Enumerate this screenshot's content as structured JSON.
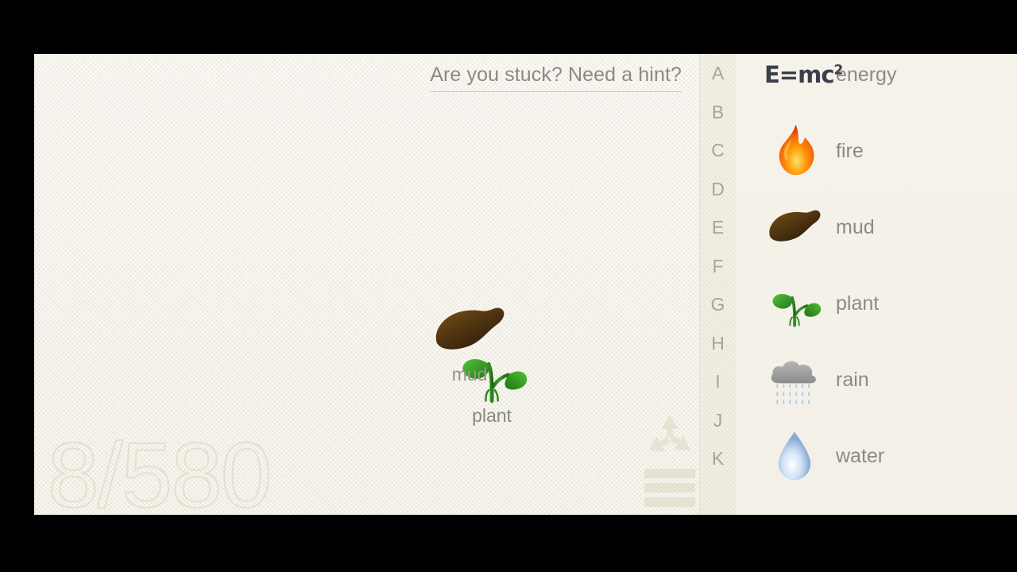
{
  "game": {
    "hint_text": "Are you stuck? Need a hint?",
    "score": "8/580",
    "colors": {
      "paper": "#f3f0e7",
      "text": "#8e8a83",
      "score_outline": "#e6dfcd",
      "divider": "#e4ddc9"
    }
  },
  "tools": [
    {
      "name": "recycle-icon",
      "label": "recycle"
    },
    {
      "name": "menu-icon",
      "label": "menu"
    }
  ],
  "board": {
    "nodes": [
      {
        "label": "plant",
        "icon": "plant"
      },
      {
        "label": "mud",
        "icon": "mud"
      }
    ]
  },
  "alphabet": {
    "letters": [
      "A",
      "B",
      "C",
      "D",
      "E",
      "F",
      "G",
      "H",
      "I",
      "J",
      "K"
    ]
  },
  "library": {
    "items": [
      {
        "label": "energy",
        "icon": "energy"
      },
      {
        "label": "fire",
        "icon": "fire"
      },
      {
        "label": "mud",
        "icon": "mud"
      },
      {
        "label": "plant",
        "icon": "plant"
      },
      {
        "label": "rain",
        "icon": "rain"
      },
      {
        "label": "water",
        "icon": "water"
      }
    ]
  }
}
